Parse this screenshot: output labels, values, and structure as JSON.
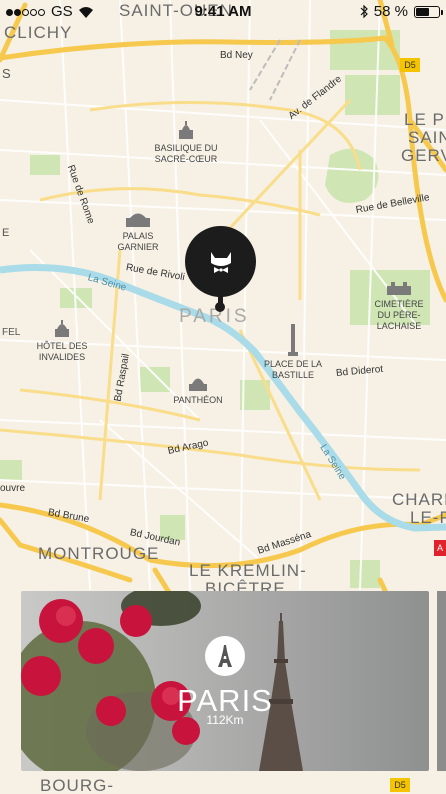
{
  "status_bar": {
    "carrier": "GS",
    "signal_dots": [
      1,
      1,
      0,
      0,
      0
    ],
    "time": "9:41 AM",
    "battery_text": "58 %",
    "battery_level": 0.58,
    "icons": [
      "wifi-icon",
      "bluetooth-icon",
      "battery-icon"
    ]
  },
  "map": {
    "city_label": "PARIS",
    "area_labels": {
      "saint_ouen": "SAINT-OUEN",
      "clichy": "CLICHY",
      "montrouge": "MONTROUGE",
      "kremlin_line1": "LE KREMLIN-",
      "kremlin_line2": "BICÊTRE",
      "bourg": "BOURG-",
      "charenton_line1": "CHARE",
      "charenton_line2": "LE-P",
      "le_pre_line1": "LE PR",
      "le_pre_line2": "SAIN",
      "le_pre_line3": "GERV",
      "edge_left1": "S",
      "edge_left2": "E",
      "edge_left3": "FEL",
      "edge_left4": "ouvre"
    },
    "roads": {
      "bd_ney": "Bd Ney",
      "av_flandre": "Av. de Flandre",
      "rue_rome": "Rue de Rome",
      "rue_belleville": "Rue de Belleville",
      "rue_rivoli": "Rue de Rivoli",
      "la_seine": "La Seine",
      "la_seine_2": "La Seine",
      "bd_raspail": "Bd Raspail",
      "bd_diderot": "Bd Diderot",
      "bd_arago": "Bd Arago",
      "bd_brune": "Bd Brune",
      "bd_jourdan": "Bd Jourdan",
      "bd_massena": "Bd Masséna"
    },
    "pois": {
      "sacre_coeur_1": "BASILIQUE DU",
      "sacre_coeur_2": "SACRÉ-CŒUR",
      "palais_garnier_1": "PALAIS",
      "palais_garnier_2": "GARNIER",
      "invalides_1": "HÔTEL DES",
      "invalides_2": "INVALIDES",
      "pantheon": "PANTHÉON",
      "bastille_1": "PLACE DE LA",
      "bastille_2": "BASTILLE",
      "pere_lachaise_1": "CIMETIÈRE",
      "pere_lachaise_2": "DU PÈRE-",
      "pere_lachaise_3": "LACHAISE"
    },
    "shields": {
      "d5_top": "D5",
      "d5_bottom": "D5",
      "a_badge": "A"
    },
    "marker_icon": "cat-bowtie-icon"
  },
  "card": {
    "title": "PARIS",
    "distance": "112Km",
    "icon": "eiffel-tower-icon"
  }
}
